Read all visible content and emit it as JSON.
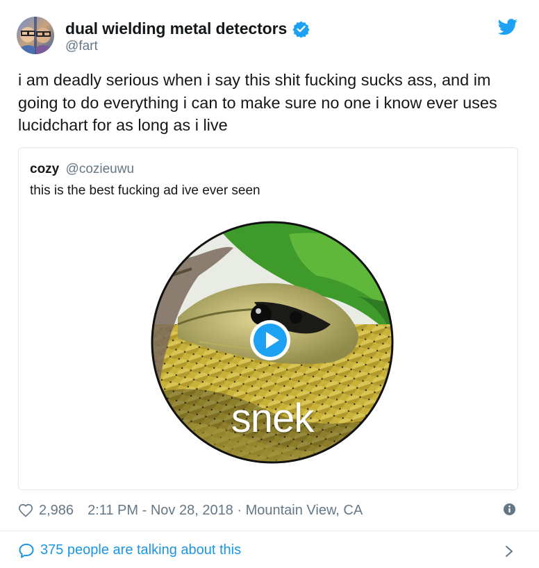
{
  "author": {
    "name": "dual wielding metal detectors",
    "handle": "@fart",
    "verified": true
  },
  "tweet": {
    "text": "i am deadly serious when i say this shit fucking sucks ass, and im going to do everything i can to make sure no one i know ever uses lucidchart for as long as i live"
  },
  "quoted_tweet": {
    "name": "cozy",
    "handle": "@cozieuwu",
    "text": "this is the best fucking ad ive ever seen",
    "media": {
      "type": "video",
      "caption": "snek",
      "play_icon": "play-icon"
    }
  },
  "footer": {
    "likes": "2,986",
    "timestamp": "2:11 PM - Nov 28, 2018 · Mountain View, CA",
    "talking": "375 people are talking about this"
  },
  "colors": {
    "accent": "#1da1f2",
    "link": "#1b95e0",
    "secondary_text": "#657786",
    "border": "#e1e8ed"
  }
}
